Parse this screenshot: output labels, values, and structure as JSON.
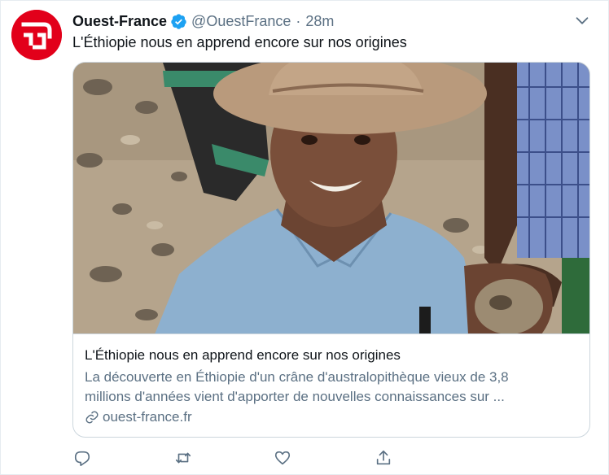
{
  "tweet": {
    "author_name": "Ouest-France",
    "handle": "@OuestFrance",
    "separator": "·",
    "time": "28m",
    "text": "L'Éthiopie nous en apprend encore sur nos origines",
    "verified": true,
    "avatar_icon": "ouest-france-logo",
    "brand_color": "#e2001a"
  },
  "card": {
    "image_alt": "photo",
    "title": "L'Éthiopie nous en apprend encore sur nos origines",
    "description_line1": "La découverte en Éthiopie d'un crâne d'australopithèque vieux de 3,8",
    "description_line2": "millions d'années vient d'apporter de nouvelles connaissances sur ...",
    "domain": "ouest-france.fr",
    "link_icon": "link-icon"
  },
  "actions": {
    "reply_icon": "reply-icon",
    "retweet_icon": "retweet-icon",
    "like_icon": "heart-icon",
    "share_icon": "share-icon"
  },
  "colors": {
    "text": "#0f1419",
    "secondary": "#5b7083",
    "verified": "#1da1f2",
    "border": "#ccd6dd"
  }
}
